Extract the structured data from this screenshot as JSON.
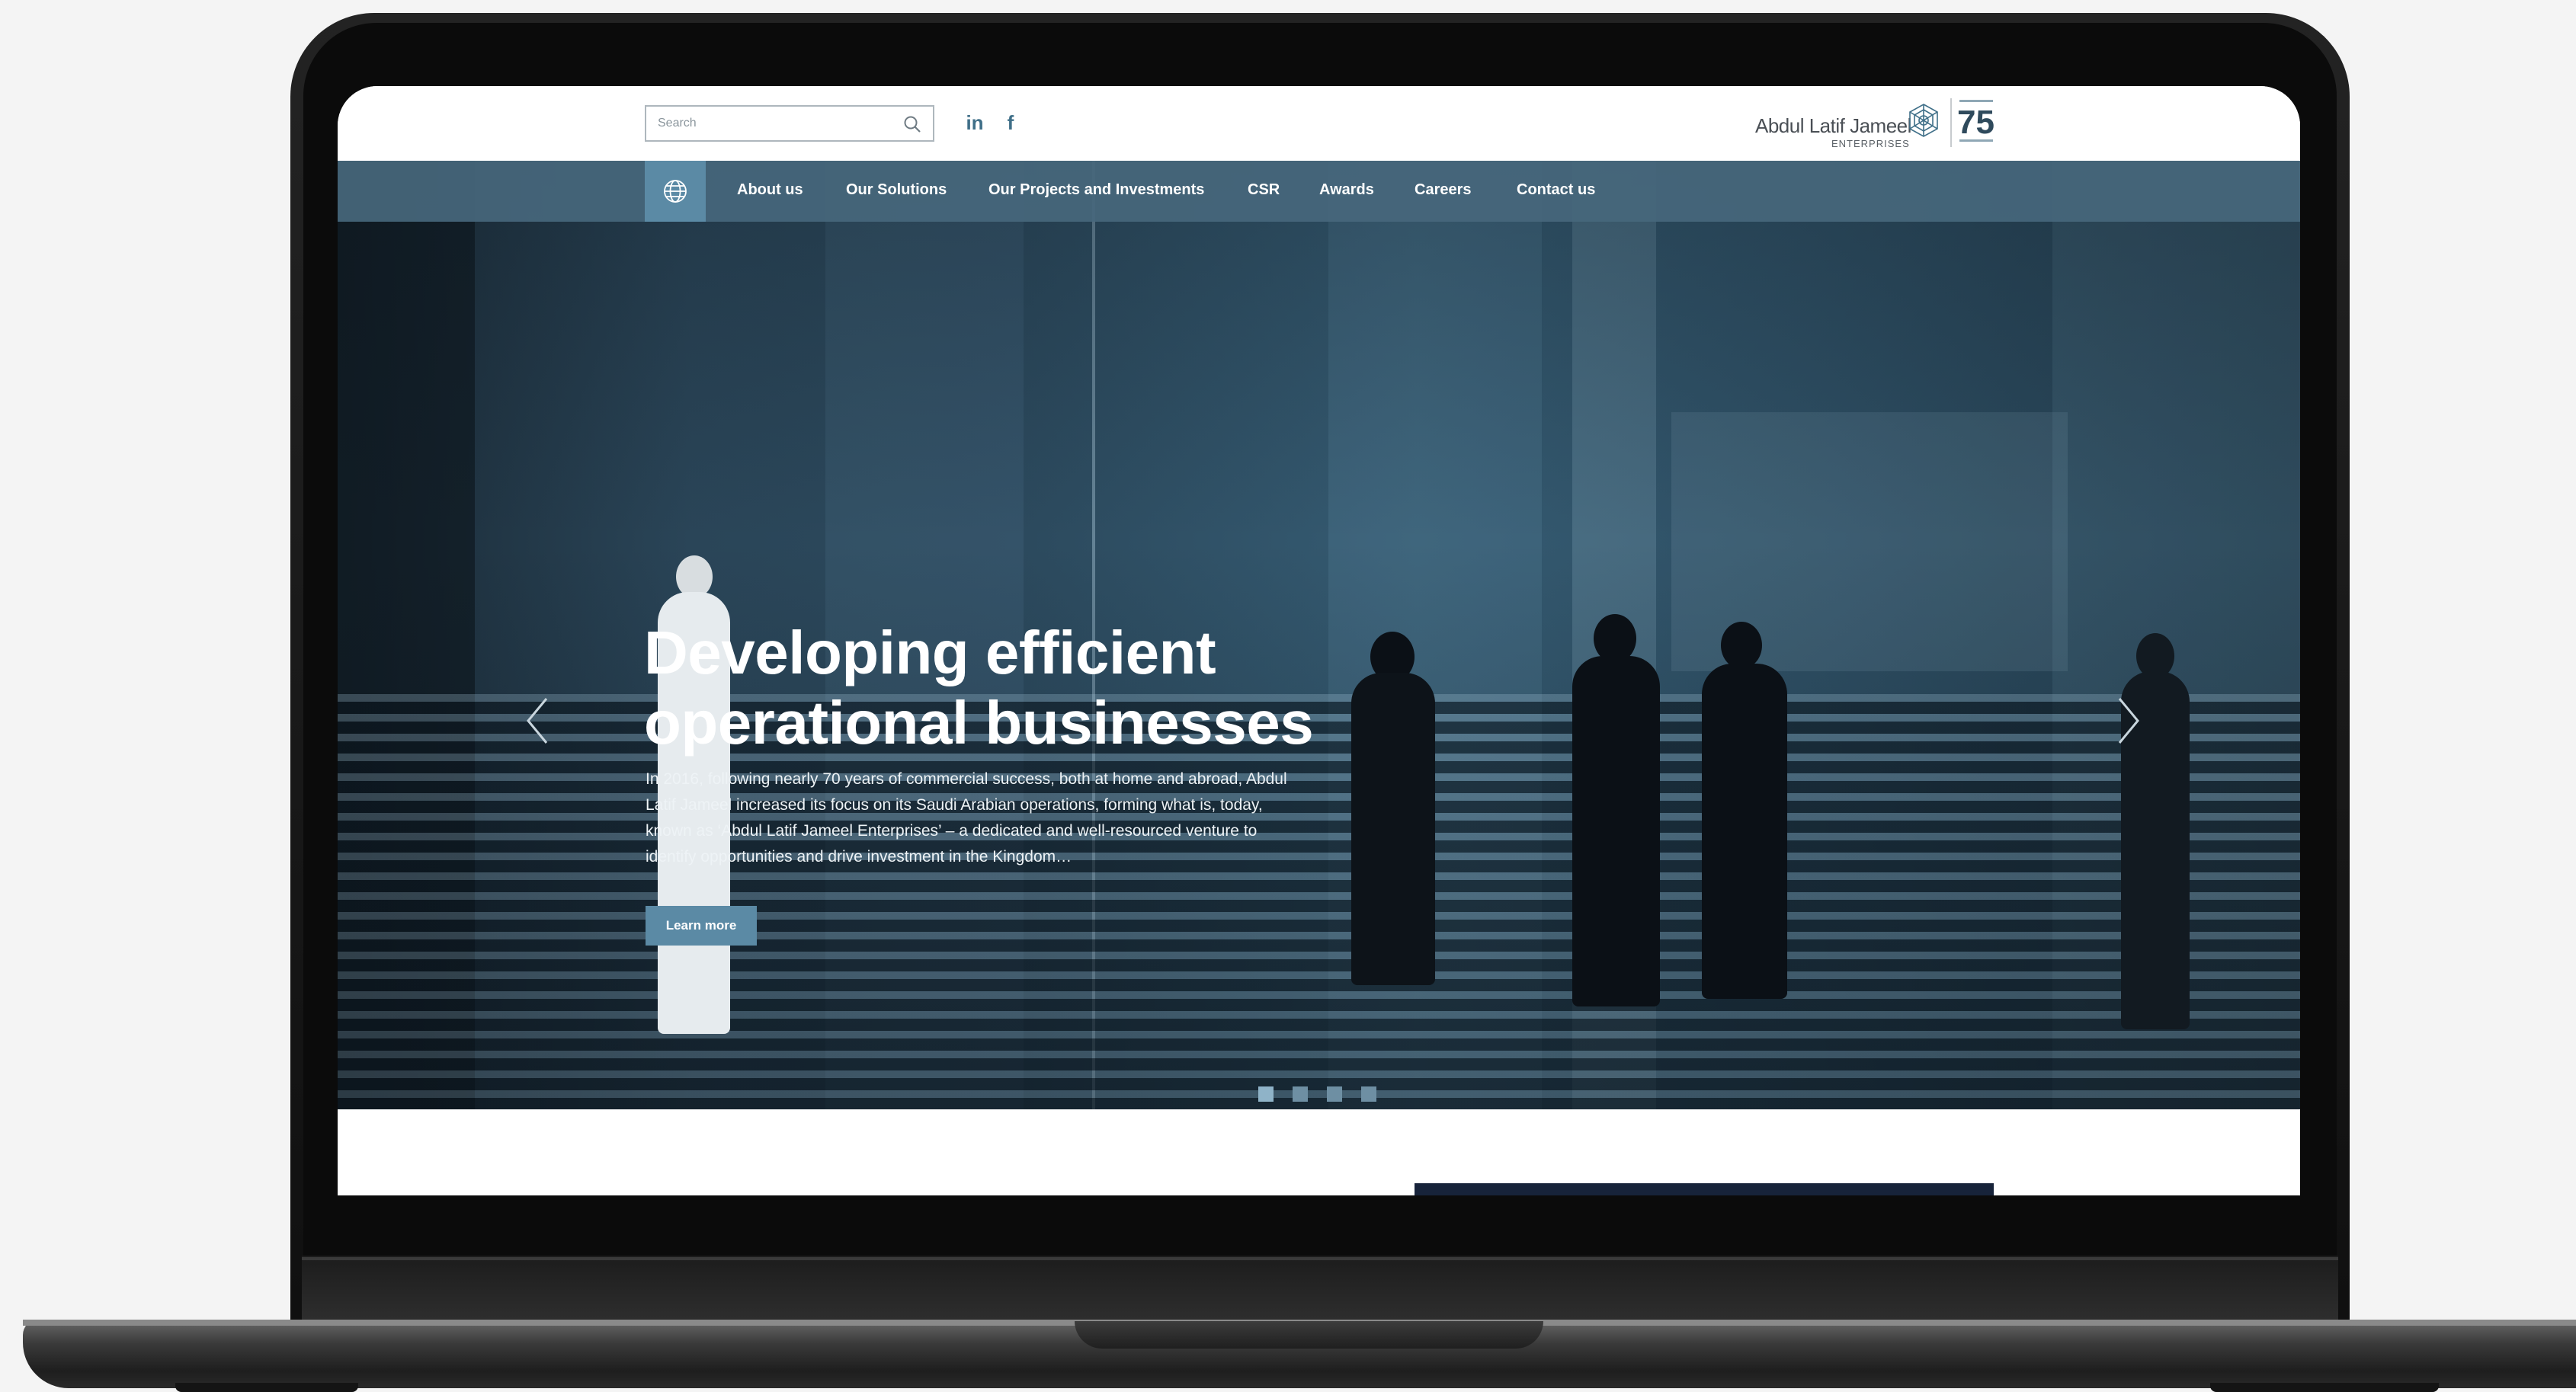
{
  "search": {
    "placeholder": "Search"
  },
  "social": {
    "linkedin": "in",
    "facebook": "f"
  },
  "logo": {
    "name": "Abdul Latif Jameel",
    "sub": "ENTERPRISES"
  },
  "nav": {
    "items": [
      {
        "label": "About us"
      },
      {
        "label": "Our Solutions"
      },
      {
        "label": "Our Projects and Investments"
      },
      {
        "label": "CSR"
      },
      {
        "label": "Awards"
      },
      {
        "label": "Careers"
      },
      {
        "label": "Contact us"
      }
    ]
  },
  "hero": {
    "title_line1": "Developing efficient",
    "title_line2": "operational businesses",
    "body": "In 2016, following nearly 70 years of commercial success, both at home and abroad, Abdul Latif Jameel increased its focus on its Saudi Arabian operations, forming what is, today, known as ‘Abdul Latif Jameel Enterprises’ – a dedicated and well-resourced venture to identify opportunities and drive investment in the Kingdom…",
    "button": "Learn more"
  },
  "carousel": {
    "slide_count": 4,
    "active_index": 0
  },
  "colors": {
    "nav": "#46677c",
    "accent": "#5b8aa5"
  }
}
